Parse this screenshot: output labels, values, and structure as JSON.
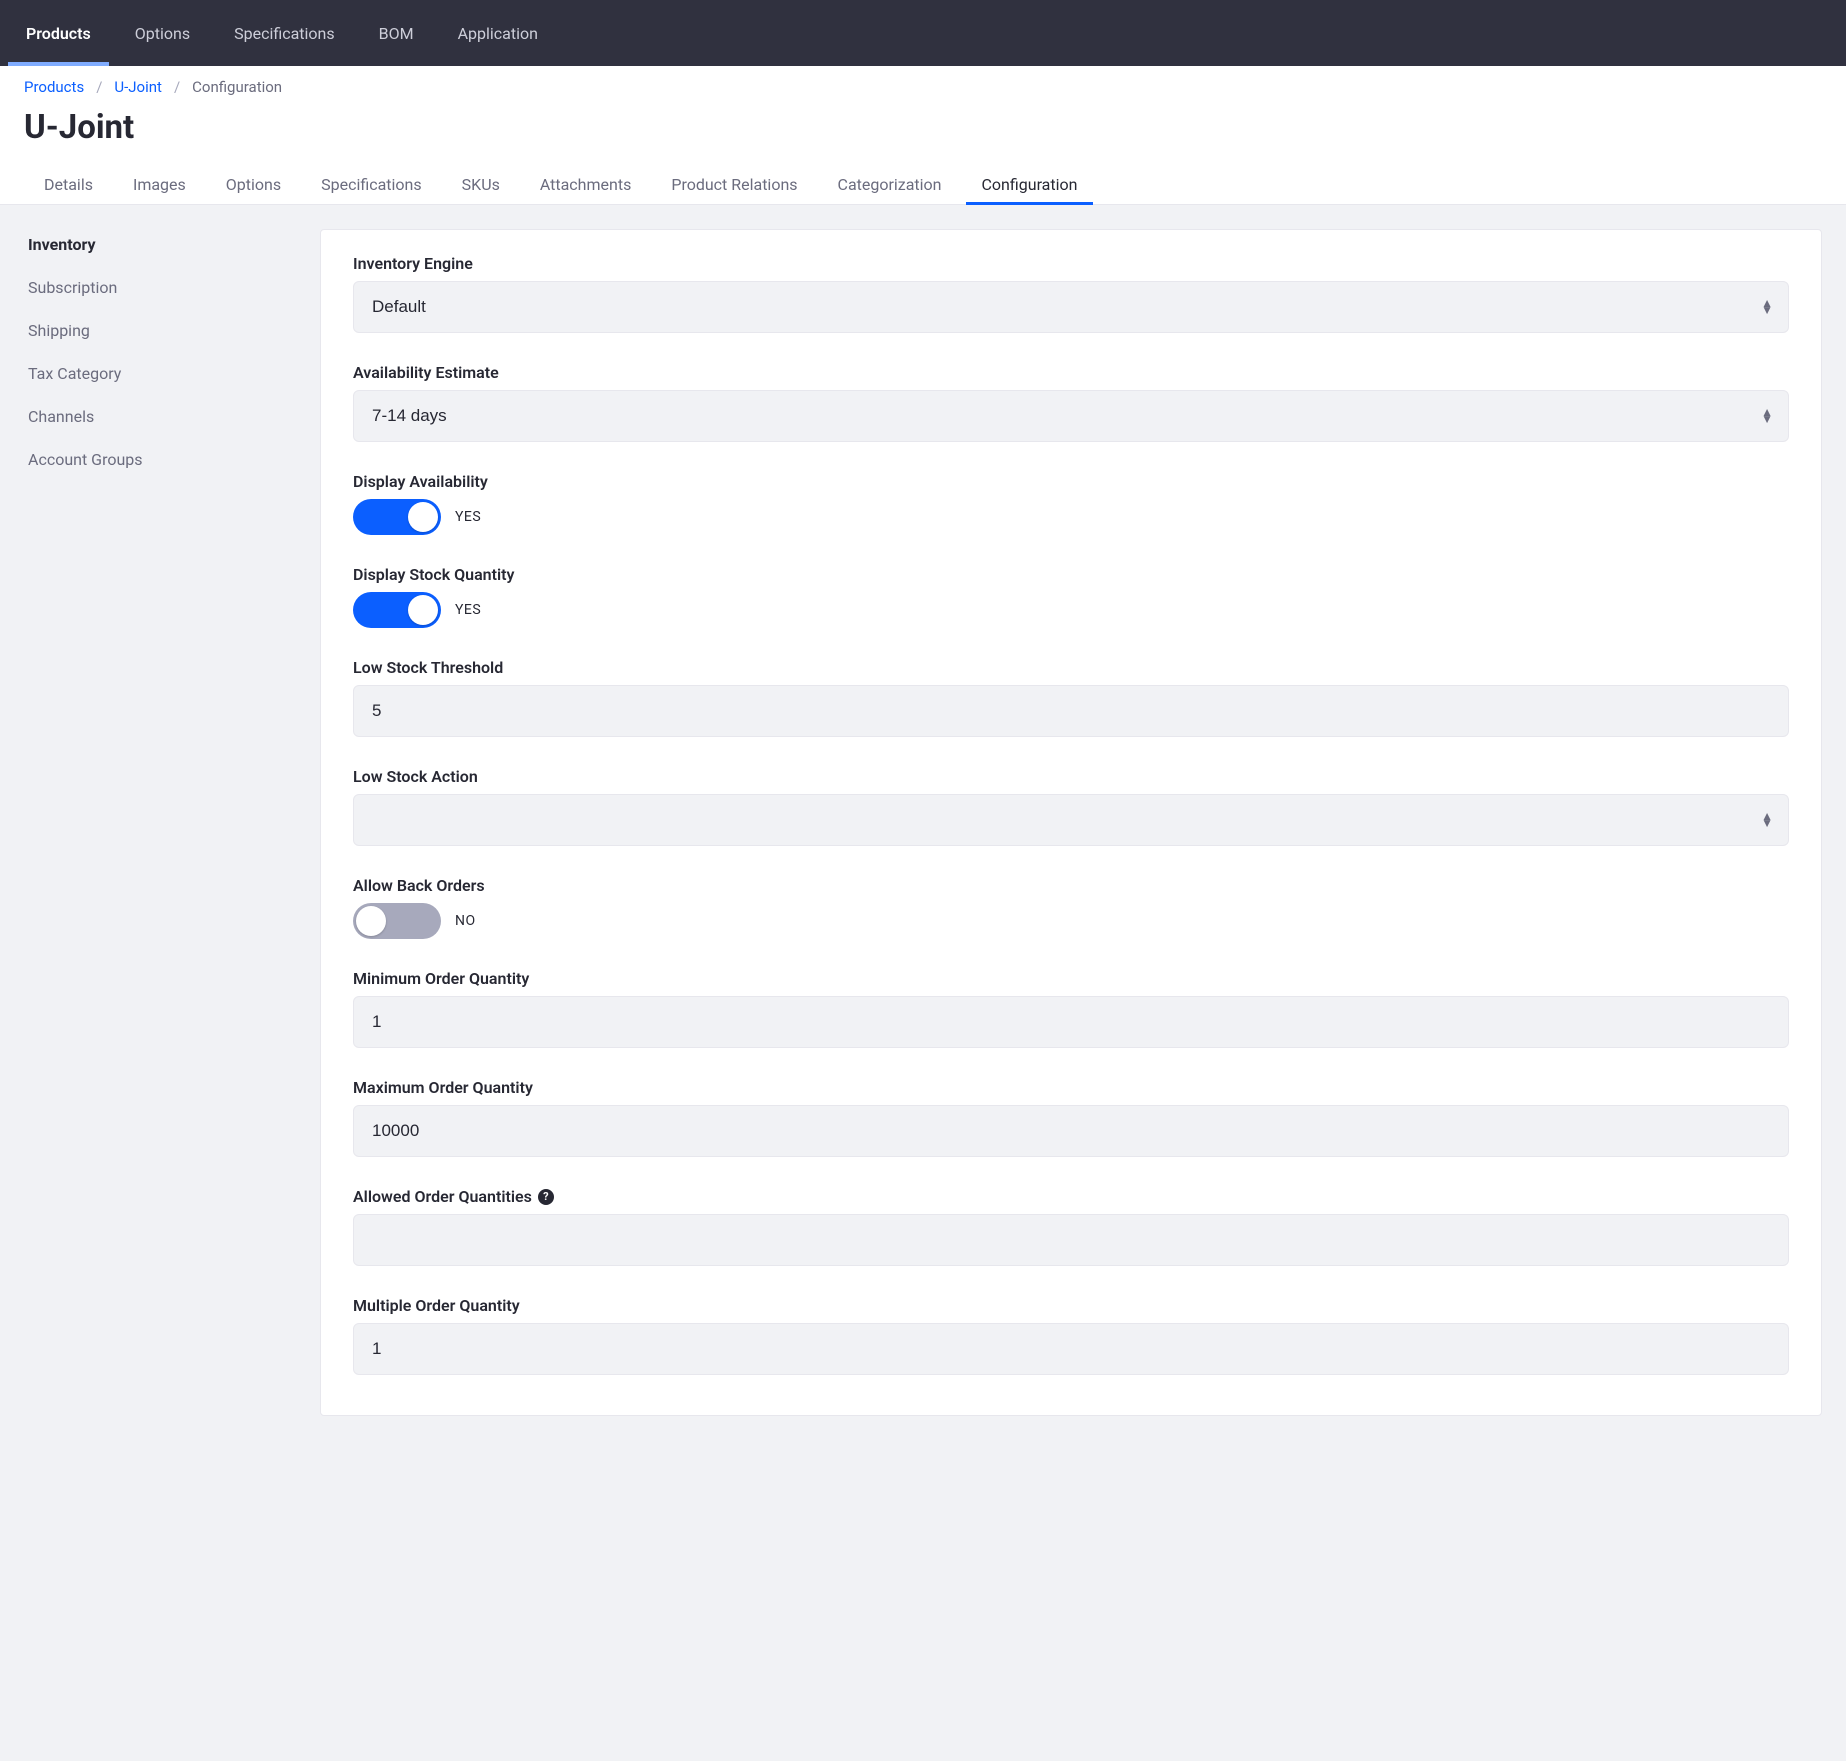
{
  "topnav": {
    "items": [
      {
        "label": "Products",
        "active": true
      },
      {
        "label": "Options",
        "active": false
      },
      {
        "label": "Specifications",
        "active": false
      },
      {
        "label": "BOM",
        "active": false
      },
      {
        "label": "Application",
        "active": false
      }
    ]
  },
  "breadcrumb": {
    "items": [
      {
        "label": "Products",
        "link": true
      },
      {
        "label": "U-Joint",
        "link": true
      },
      {
        "label": "Configuration",
        "link": false
      }
    ],
    "separator": "/"
  },
  "page_title": "U-Joint",
  "subtabs": {
    "items": [
      {
        "label": "Details",
        "active": false
      },
      {
        "label": "Images",
        "active": false
      },
      {
        "label": "Options",
        "active": false
      },
      {
        "label": "Specifications",
        "active": false
      },
      {
        "label": "SKUs",
        "active": false
      },
      {
        "label": "Attachments",
        "active": false
      },
      {
        "label": "Product Relations",
        "active": false
      },
      {
        "label": "Categorization",
        "active": false
      },
      {
        "label": "Configuration",
        "active": true
      }
    ]
  },
  "sidebar": {
    "items": [
      {
        "label": "Inventory",
        "active": true
      },
      {
        "label": "Subscription",
        "active": false
      },
      {
        "label": "Shipping",
        "active": false
      },
      {
        "label": "Tax Category",
        "active": false
      },
      {
        "label": "Channels",
        "active": false
      },
      {
        "label": "Account Groups",
        "active": false
      }
    ]
  },
  "form": {
    "inventory_engine": {
      "label": "Inventory Engine",
      "value": "Default"
    },
    "availability_estimate": {
      "label": "Availability Estimate",
      "value": "7-14 days"
    },
    "display_availability": {
      "label": "Display Availability",
      "value": true,
      "text": "YES"
    },
    "display_stock_quantity": {
      "label": "Display Stock Quantity",
      "value": true,
      "text": "YES"
    },
    "low_stock_threshold": {
      "label": "Low Stock Threshold",
      "value": "5"
    },
    "low_stock_action": {
      "label": "Low Stock Action",
      "value": ""
    },
    "allow_back_orders": {
      "label": "Allow Back Orders",
      "value": false,
      "text": "NO"
    },
    "min_order_qty": {
      "label": "Minimum Order Quantity",
      "value": "1"
    },
    "max_order_qty": {
      "label": "Maximum Order Quantity",
      "value": "10000"
    },
    "allowed_order_qty": {
      "label": "Allowed Order Quantities",
      "value": "",
      "help": "?"
    },
    "multiple_order_qty": {
      "label": "Multiple Order Quantity",
      "value": "1"
    }
  }
}
